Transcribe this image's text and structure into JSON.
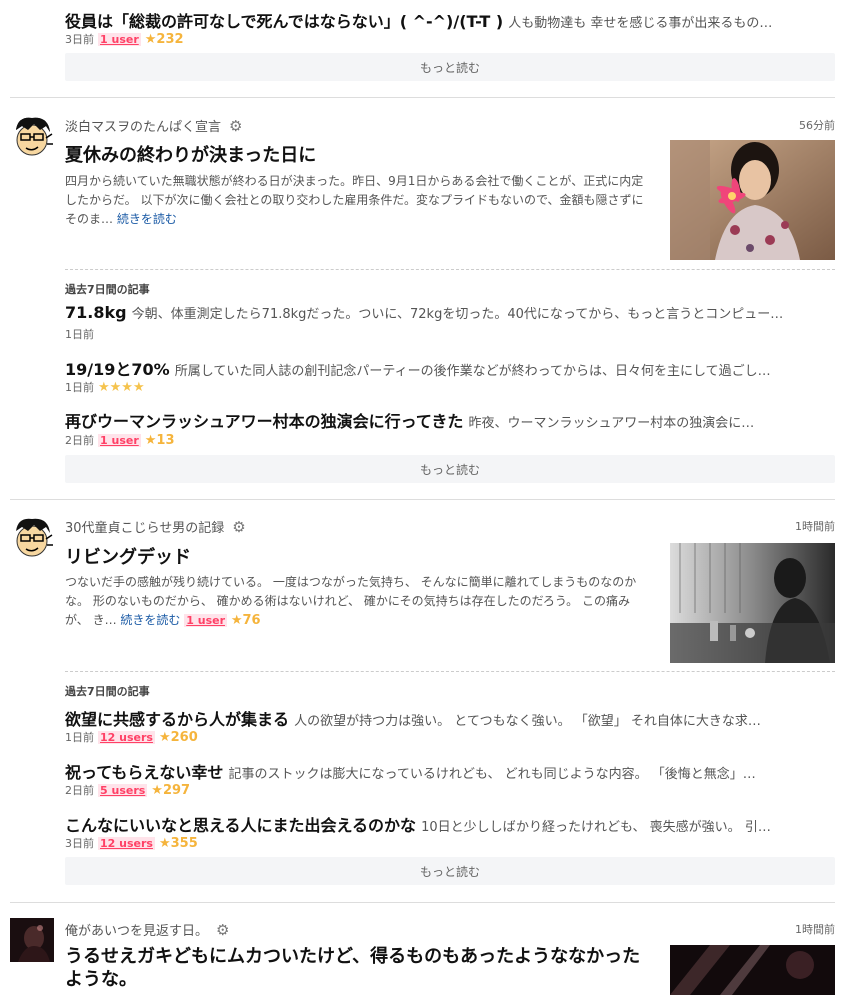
{
  "top_item": {
    "title": "役員は「総裁の許可なしで死んではならない」( ^-^)/(T-T )",
    "snippet": "人も動物達も 幸せを感じる事が出来るもの…",
    "date": "3日前",
    "users": "1 user",
    "stars": "★232",
    "more": "もっと読む"
  },
  "blogs": [
    {
      "name": "淡白マスヲのたんぱく宣言",
      "time": "56分前",
      "title": "夏休みの終わりが決まった日に",
      "description": "四月から続いていた無職状態が終わる日が決まった。昨日、9月1日からある会社で働くことが、正式に内定したからだ。 以下が次に働く会社との取り交わした雇用条件だ。変なプライドもないので、金額も隠さずにそのま…",
      "read_more": "続きを読む",
      "past_label": "過去7日間の記事",
      "past": [
        {
          "title": "71.8kg",
          "snippet": "今朝、体重測定したら71.8kgだった。ついに、72kgを切った。40代になってから、もっと言うとコンピュー…",
          "date": "1日前",
          "users": "",
          "stars": ""
        },
        {
          "title": "19/19と70%",
          "snippet": "所属していた同人誌の創刊記念パーティーの後作業などが終わってからは、日々何を主にして過ごし…",
          "date": "1日前",
          "users": "",
          "stars": "★★★★"
        },
        {
          "title": "再びウーマンラッシュアワー村本の独演会に行ってきた",
          "snippet": "昨夜、ウーマンラッシュアワー村本の独演会に…",
          "date": "2日前",
          "users": "1 user",
          "stars": "★13"
        }
      ],
      "more": "もっと読む"
    },
    {
      "name": "30代童貞こじらせ男の記録",
      "time": "1時間前",
      "title": "リビングデッド",
      "description": "つないだ手の感触が残り続けている。 一度はつながった気持ち、 そんなに簡単に離れてしまうものなのかな。 形のないものだから、 確かめる術はないけれど、 確かにその気持ちは存在したのだろう。 この痛みが、 き…",
      "read_more": "続きを読む",
      "users": "1 user",
      "stars": "★76",
      "past_label": "過去7日間の記事",
      "past": [
        {
          "title": "欲望に共感するから人が集まる",
          "snippet": "人の欲望が持つ力は強い。 とてつもなく強い。 「欲望」 それ自体に大きな求…",
          "date": "1日前",
          "users": "12 users",
          "stars": "★260"
        },
        {
          "title": "祝ってもらえない幸せ",
          "snippet": "記事のストックは膨大になっているけれども、 どれも同じような内容。 「後悔と無念」…",
          "date": "2日前",
          "users": "5 users",
          "stars": "★297"
        },
        {
          "title": "こんなにいいなと思える人にまた出会えるのかな",
          "snippet": "10日と少ししばかり経ったけれども、 喪失感が強い。 引…",
          "date": "3日前",
          "users": "12 users",
          "stars": "★355"
        }
      ],
      "more": "もっと読む"
    },
    {
      "name": "俺があいつを見返す日。",
      "time": "1時間前",
      "title": "うるせえガキどもにムカついたけど、得るものもあったようななかったような。"
    }
  ]
}
